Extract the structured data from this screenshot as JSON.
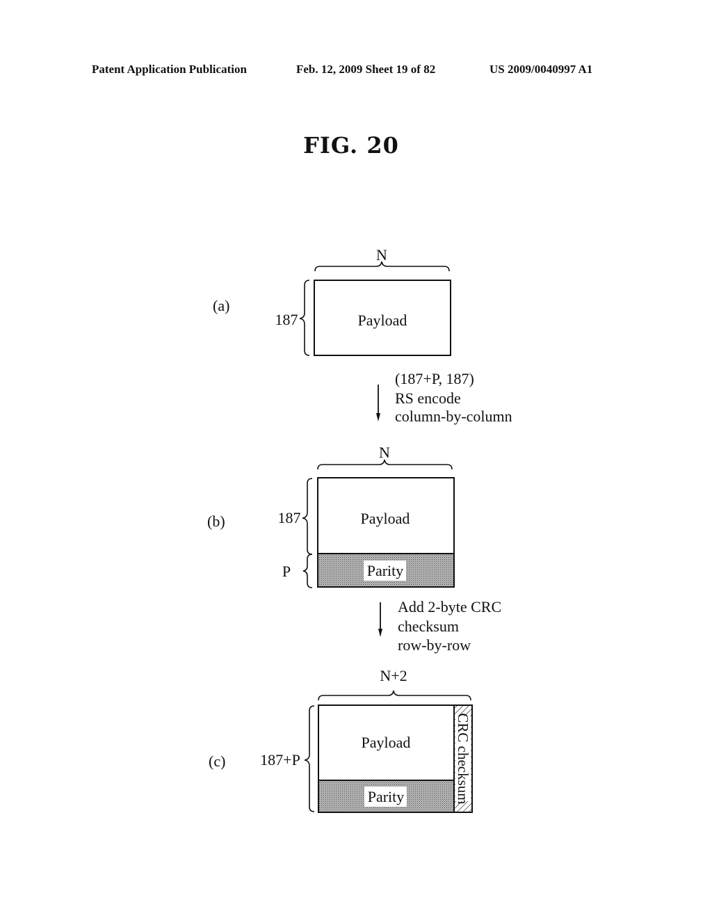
{
  "header": {
    "left": "Patent Application Publication",
    "middle": "Feb. 12, 2009  Sheet 19 of 82",
    "right": "US 2009/0040997 A1"
  },
  "figure": {
    "title": "FIG. 20",
    "panels": {
      "a": {
        "label": "(a)",
        "width_label": "N",
        "height_label": "187",
        "payload_label": "Payload"
      },
      "step1": {
        "lines": [
          "(187+P, 187)",
          "RS encode",
          "column-by-column"
        ]
      },
      "b": {
        "label": "(b)",
        "width_label": "N",
        "payload_height_label": "187",
        "parity_height_label": "P",
        "payload_label": "Payload",
        "parity_label": "Parity"
      },
      "step2": {
        "lines": [
          "Add 2-byte CRC",
          "checksum",
          "row-by-row"
        ]
      },
      "c": {
        "label": "(c)",
        "width_label": "N+2",
        "height_label": "187+P",
        "payload_label": "Payload",
        "parity_label": "Parity",
        "crc_label": "CRC checksum"
      }
    }
  }
}
